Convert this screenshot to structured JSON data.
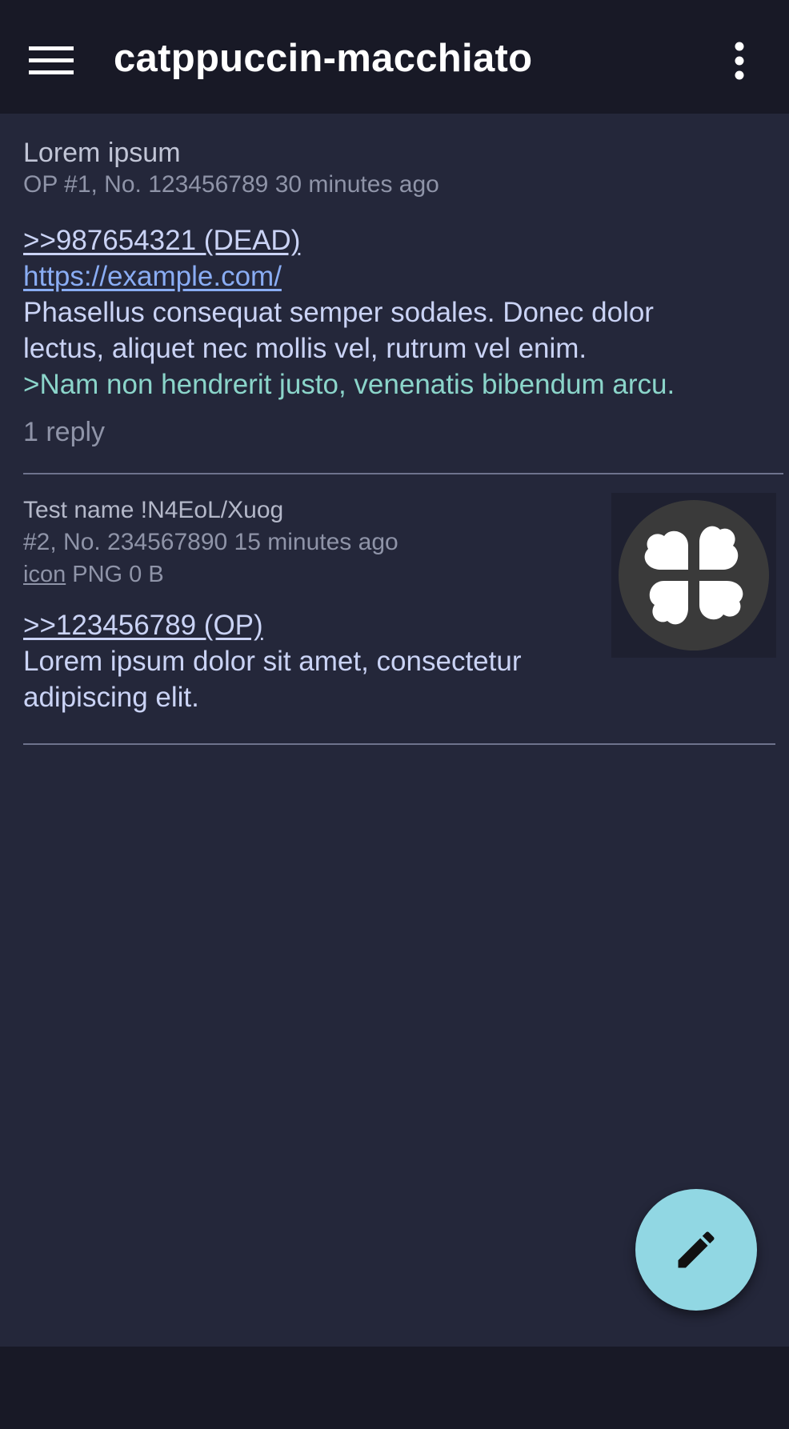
{
  "appbar": {
    "title": "catppuccin-macchiato",
    "menu_icon": "hamburger-menu-icon",
    "overflow_icon": "more-vert-icon"
  },
  "posts": [
    {
      "subject": "Lorem ipsum",
      "meta": "OP #1, No. 123456789 30 minutes ago",
      "quote_link": ">>987654321 (DEAD)",
      "url": "https://example.com/",
      "body_line1": "Phasellus consequat semper sodales. Donec dolor",
      "body_line2": "lectus, aliquet nec mollis vel, rutrum vel enim.",
      "greentext": ">Nam non hendrerit justo, venenatis bibendum arcu.",
      "replies": "1 reply"
    },
    {
      "name": "Test name !N4EoL/Xuog",
      "meta": "#2, No. 234567890 15 minutes ago",
      "file_name": "icon",
      "file_info": "PNG 0 B",
      "quote_link": ">>123456789 (OP)",
      "body_line1": "Lorem ipsum dolor sit amet, consectetur",
      "body_line2": "adipiscing elit.",
      "thumbnail_icon": "clover-logo-icon"
    }
  ],
  "fab": {
    "icon": "pencil-edit-icon"
  },
  "colors": {
    "background": "#24273a",
    "appbar": "#181926",
    "text": "#cad3f5",
    "link": "#8aadf4",
    "greentext": "#8bd5ca",
    "fab": "#91d7e3"
  }
}
